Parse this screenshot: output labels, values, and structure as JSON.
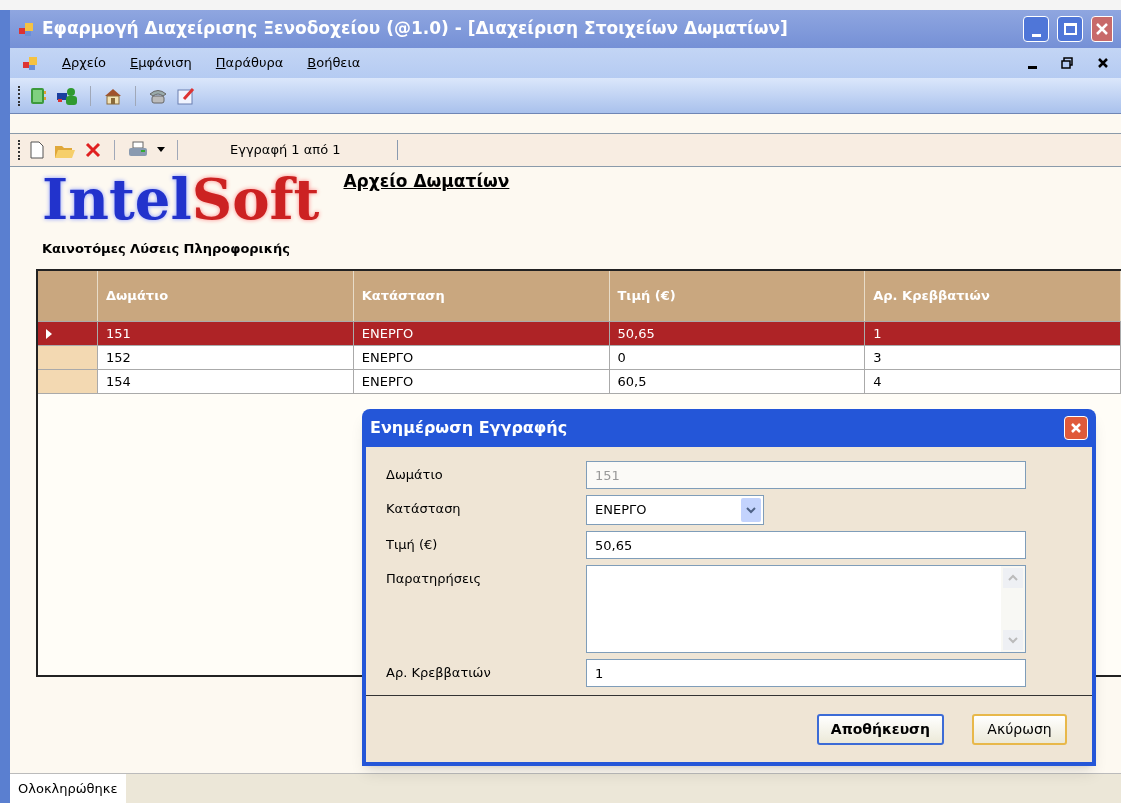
{
  "window": {
    "title": "Εφαρμογή Διαχείρισης Ξενοδοχείου (@1.0) - [Διαχείριση Στοιχείων Δωματίων]"
  },
  "menu": {
    "items": [
      "Αρχείο",
      "Εμφάνιση",
      "Παράθυρα",
      "Βοήθεια"
    ]
  },
  "record_toolbar": {
    "record_label": "Εγγραφή 1 από 1"
  },
  "logo": {
    "text_1": "Intel",
    "text_2": "Soft",
    "tagline": "Καινοτόμες Λύσεις Πληροφορικής"
  },
  "heading": "Αρχείο Δωματίων",
  "table": {
    "columns": [
      "Δωμάτιο",
      "Κατάσταση",
      "Τιμή (€)",
      "Αρ. Κρεββατιών"
    ],
    "rows": [
      {
        "selected": true,
        "cells": [
          "151",
          "ΕΝΕΡΓΟ",
          "50,65",
          "1"
        ]
      },
      {
        "selected": false,
        "cells": [
          "152",
          "ΕΝΕΡΓΟ",
          "0",
          "3"
        ]
      },
      {
        "selected": false,
        "cells": [
          "154",
          "ΕΝΕΡΓΟ",
          "60,5",
          "4"
        ]
      }
    ]
  },
  "dialog": {
    "title": "Ενημέρωση Εγγραφής",
    "fields": [
      {
        "kind": "text",
        "label": "Δωμάτιο",
        "value": "151",
        "disabled": true
      },
      {
        "kind": "select",
        "label": "Κατάσταση",
        "value": "ΕΝΕΡΓΟ",
        "disabled": false
      },
      {
        "kind": "text",
        "label": "Τιμή (€)",
        "value": "50,65",
        "disabled": false
      },
      {
        "kind": "textarea",
        "label": "Παρατηρήσεις",
        "disabled": false
      },
      {
        "kind": "text",
        "label": "Αρ. Κρεββατιών",
        "value": "1",
        "disabled": false
      }
    ],
    "buttons": [
      {
        "label": "Αποθήκευση",
        "default": true
      },
      {
        "label": "Ακύρωση",
        "default": false
      }
    ]
  },
  "status_bar": {
    "text": "Ολοκληρώθηκε"
  }
}
